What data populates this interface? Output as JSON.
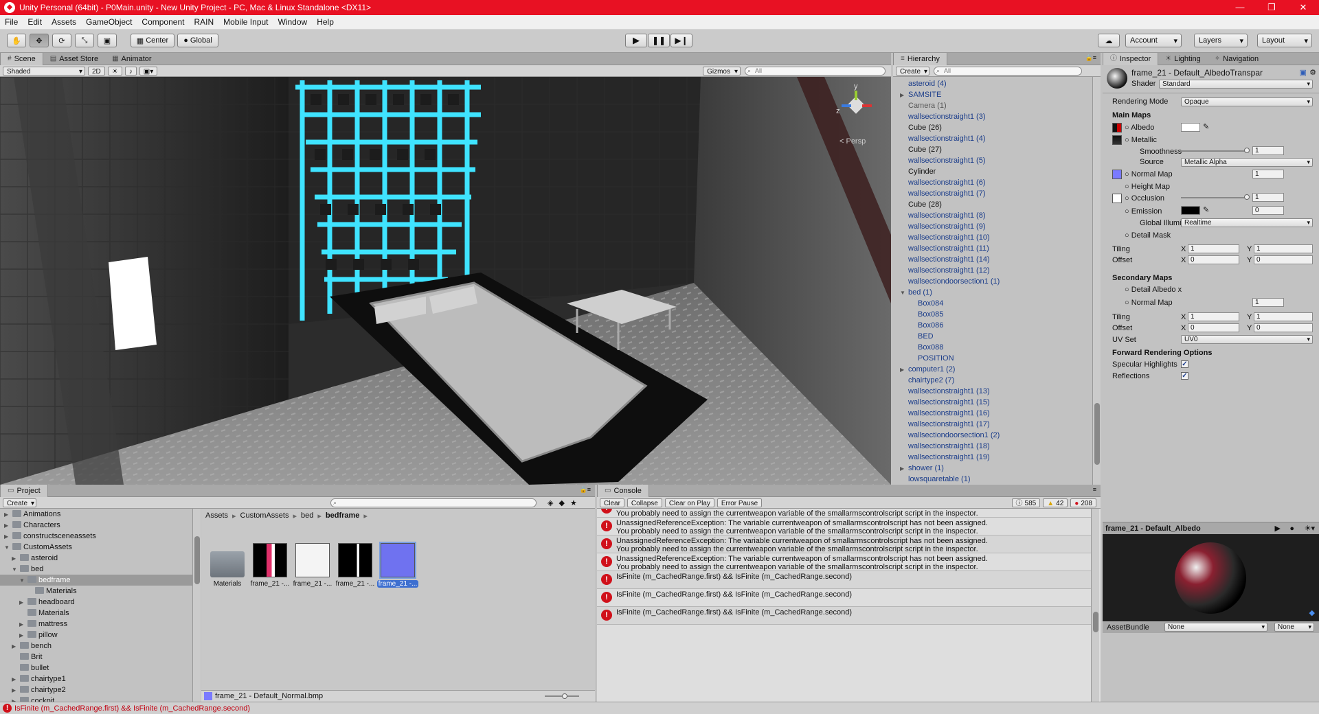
{
  "window": {
    "title": "Unity Personal (64bit) - P0Main.unity - New Unity Project - PC, Mac & Linux Standalone <DX11>"
  },
  "menu": [
    "File",
    "Edit",
    "Assets",
    "GameObject",
    "Component",
    "RAIN",
    "Mobile Input",
    "Window",
    "Help"
  ],
  "toolbar": {
    "pivot": "Center",
    "space": "Global",
    "account": "Account",
    "layers": "Layers",
    "layout": "Layout"
  },
  "scene": {
    "tabs": [
      "Scene",
      "Asset Store",
      "Animator"
    ],
    "shading": "Shaded",
    "mode2d": "2D",
    "gizmos": "Gizmos",
    "search": "All",
    "persp": "< Persp",
    "axis_y": "y",
    "axis_z": "z"
  },
  "hierarchy": {
    "tab": "Hierarchy",
    "create": "Create",
    "search": "All",
    "items": [
      {
        "label": "asteroid (4)",
        "indent": 0,
        "style": "blue",
        "arrow": ""
      },
      {
        "label": "SAMSITE",
        "indent": 0,
        "style": "blue",
        "arrow": "▶"
      },
      {
        "label": "Camera (1)",
        "indent": 0,
        "style": "grey",
        "arrow": ""
      },
      {
        "label": "wallsectionstraight1 (3)",
        "indent": 0,
        "style": "blue",
        "arrow": ""
      },
      {
        "label": "Cube (26)",
        "indent": 0,
        "style": "black",
        "arrow": ""
      },
      {
        "label": "wallsectionstraight1 (4)",
        "indent": 0,
        "style": "blue",
        "arrow": ""
      },
      {
        "label": "Cube (27)",
        "indent": 0,
        "style": "black",
        "arrow": ""
      },
      {
        "label": "wallsectionstraight1 (5)",
        "indent": 0,
        "style": "blue",
        "arrow": ""
      },
      {
        "label": "Cylinder",
        "indent": 0,
        "style": "black",
        "arrow": ""
      },
      {
        "label": "wallsectionstraight1 (6)",
        "indent": 0,
        "style": "blue",
        "arrow": ""
      },
      {
        "label": "wallsectionstraight1 (7)",
        "indent": 0,
        "style": "blue",
        "arrow": ""
      },
      {
        "label": "Cube (28)",
        "indent": 0,
        "style": "black",
        "arrow": ""
      },
      {
        "label": "wallsectionstraight1 (8)",
        "indent": 0,
        "style": "blue",
        "arrow": ""
      },
      {
        "label": "wallsectionstraight1 (9)",
        "indent": 0,
        "style": "blue",
        "arrow": ""
      },
      {
        "label": "wallsectionstraight1 (10)",
        "indent": 0,
        "style": "blue",
        "arrow": ""
      },
      {
        "label": "wallsectionstraight1 (11)",
        "indent": 0,
        "style": "blue",
        "arrow": ""
      },
      {
        "label": "wallsectionstraight1 (14)",
        "indent": 0,
        "style": "blue",
        "arrow": ""
      },
      {
        "label": "wallsectionstraight1 (12)",
        "indent": 0,
        "style": "blue",
        "arrow": ""
      },
      {
        "label": "wallsectiondoorsection1 (1)",
        "indent": 0,
        "style": "blue",
        "arrow": ""
      },
      {
        "label": "bed (1)",
        "indent": 0,
        "style": "blue",
        "arrow": "▼"
      },
      {
        "label": "Box084",
        "indent": 1,
        "style": "blue",
        "arrow": ""
      },
      {
        "label": "Box085",
        "indent": 1,
        "style": "blue",
        "arrow": ""
      },
      {
        "label": "Box086",
        "indent": 1,
        "style": "blue",
        "arrow": ""
      },
      {
        "label": "BED",
        "indent": 1,
        "style": "blue",
        "arrow": ""
      },
      {
        "label": "Box088",
        "indent": 1,
        "style": "blue",
        "arrow": ""
      },
      {
        "label": "POSITION",
        "indent": 1,
        "style": "blue",
        "arrow": ""
      },
      {
        "label": "computer1 (2)",
        "indent": 0,
        "style": "blue",
        "arrow": "▶"
      },
      {
        "label": "chairtype2 (7)",
        "indent": 0,
        "style": "blue",
        "arrow": ""
      },
      {
        "label": "wallsectionstraight1 (13)",
        "indent": 0,
        "style": "blue",
        "arrow": ""
      },
      {
        "label": "wallsectionstraight1 (15)",
        "indent": 0,
        "style": "blue",
        "arrow": ""
      },
      {
        "label": "wallsectionstraight1 (16)",
        "indent": 0,
        "style": "blue",
        "arrow": ""
      },
      {
        "label": "wallsectionstraight1 (17)",
        "indent": 0,
        "style": "blue",
        "arrow": ""
      },
      {
        "label": "wallsectiondoorsection1 (2)",
        "indent": 0,
        "style": "blue",
        "arrow": ""
      },
      {
        "label": "wallsectionstraight1 (18)",
        "indent": 0,
        "style": "blue",
        "arrow": ""
      },
      {
        "label": "wallsectionstraight1 (19)",
        "indent": 0,
        "style": "blue",
        "arrow": ""
      },
      {
        "label": "shower (1)",
        "indent": 0,
        "style": "blue",
        "arrow": "▶"
      },
      {
        "label": "lowsquaretable (1)",
        "indent": 0,
        "style": "blue",
        "arrow": ""
      }
    ]
  },
  "inspector": {
    "tabs": [
      "Inspector",
      "Lighting",
      "Navigation"
    ],
    "name": "frame_21 - Default_AlbedoTranspar",
    "shader_label": "Shader",
    "shader": "Standard",
    "rendering_mode_label": "Rendering Mode",
    "rendering_mode": "Opaque",
    "main_maps": "Main Maps",
    "albedo": "Albedo",
    "metallic": "Metallic",
    "smoothness": "Smoothness",
    "smoothness_val": "1",
    "source": "Source",
    "source_val": "Metallic Alpha",
    "normal_map": "Normal Map",
    "normal_val": "1",
    "height_map": "Height Map",
    "occlusion": "Occlusion",
    "occlusion_val": "1",
    "emission": "Emission",
    "emission_val": "0",
    "gi": "Global Illumi",
    "gi_val": "Realtime",
    "detail_mask": "Detail Mask",
    "tiling": "Tiling",
    "offset": "Offset",
    "x": "X",
    "y": "Y",
    "one": "1",
    "zero": "0",
    "secondary_maps": "Secondary Maps",
    "detail_albedo": "Detail Albedo x",
    "normal_map2": "Normal Map",
    "normal_val2": "1",
    "uv_set": "UV Set",
    "uv_val": "UV0",
    "forward": "Forward Rendering Options",
    "specular": "Specular Highlights",
    "reflections": "Reflections",
    "preview_name": "frame_21 - Default_Albedo",
    "assetbundle": "AssetBundle",
    "ab_none1": "None",
    "ab_none2": "None"
  },
  "project": {
    "tab": "Project",
    "create": "Create",
    "tree": [
      {
        "label": "Animations",
        "indent": 1,
        "arrow": "▶"
      },
      {
        "label": "Characters",
        "indent": 1,
        "arrow": "▶"
      },
      {
        "label": "constructsceneassets",
        "indent": 1,
        "arrow": "▶"
      },
      {
        "label": "CustomAssets",
        "indent": 1,
        "arrow": "▼"
      },
      {
        "label": "asteroid",
        "indent": 2,
        "arrow": "▶"
      },
      {
        "label": "bed",
        "indent": 2,
        "arrow": "▼"
      },
      {
        "label": "bedframe",
        "indent": 3,
        "arrow": "▼",
        "selected": true
      },
      {
        "label": "Materials",
        "indent": 4,
        "arrow": ""
      },
      {
        "label": "headboard",
        "indent": 3,
        "arrow": "▶"
      },
      {
        "label": "Materials",
        "indent": 3,
        "arrow": ""
      },
      {
        "label": "mattress",
        "indent": 3,
        "arrow": "▶"
      },
      {
        "label": "pillow",
        "indent": 3,
        "arrow": "▶"
      },
      {
        "label": "bench",
        "indent": 2,
        "arrow": "▶"
      },
      {
        "label": "Brit",
        "indent": 2,
        "arrow": ""
      },
      {
        "label": "bullet",
        "indent": 2,
        "arrow": ""
      },
      {
        "label": "chairtype1",
        "indent": 2,
        "arrow": "▶"
      },
      {
        "label": "chairtype2",
        "indent": 2,
        "arrow": "▶"
      },
      {
        "label": "cockpit",
        "indent": 2,
        "arrow": "▶"
      }
    ],
    "breadcrumb": [
      "Assets",
      "CustomAssets",
      "bed",
      "bedframe"
    ],
    "assets": [
      "Materials",
      "frame_21 -...",
      "frame_21 -...",
      "frame_21 -...",
      "frame_21 -..."
    ],
    "footer": "frame_21 - Default_Normal.bmp"
  },
  "console": {
    "tab": "Console",
    "buttons": [
      "Clear",
      "Collapse",
      "Clear on Play",
      "Error Pause"
    ],
    "count_log": "585",
    "count_warn": "42",
    "count_err": "208",
    "partial": "You probably need to assign the currentweapon variable of the smallarmscontrolscript script in the inspector.",
    "rows": [
      {
        "l1": "UnassignedReferenceException: The variable currentweapon of smallarmscontrolscript has not been assigned.",
        "l2": "You probably need to assign the currentweapon variable of the smallarmscontrolscript script in the inspector."
      },
      {
        "l1": "UnassignedReferenceException: The variable currentweapon of smallarmscontrolscript has not been assigned.",
        "l2": "You probably need to assign the currentweapon variable of the smallarmscontrolscript script in the inspector."
      },
      {
        "l1": "UnassignedReferenceException: The variable currentweapon of smallarmscontrolscript has not been assigned.",
        "l2": "You probably need to assign the currentweapon variable of the smallarmscontrolscript script in the inspector."
      },
      {
        "l1": "IsFinite (m_CachedRange.first) && IsFinite (m_CachedRange.second)",
        "l2": ""
      },
      {
        "l1": "IsFinite (m_CachedRange.first) && IsFinite (m_CachedRange.second)",
        "l2": ""
      },
      {
        "l1": "IsFinite (m_CachedRange.first) && IsFinite (m_CachedRange.second)",
        "l2": ""
      }
    ]
  },
  "status": "IsFinite (m_CachedRange.first) && IsFinite (m_CachedRange.second)"
}
